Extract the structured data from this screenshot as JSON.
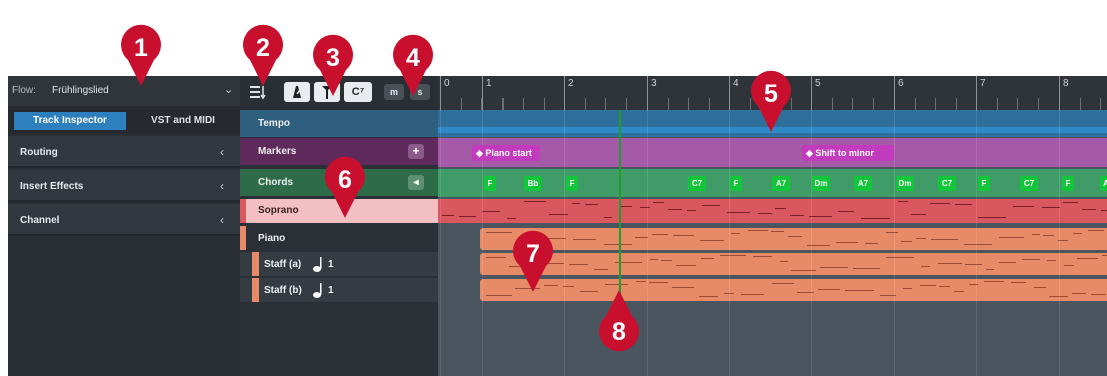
{
  "flow": {
    "label": "Flow:",
    "value": "Frühlingslied",
    "chevron": "⌄"
  },
  "tabs": [
    {
      "label": "Track Inspector",
      "active": true
    },
    {
      "label": "VST and MIDI",
      "active": false
    }
  ],
  "sections": [
    {
      "label": "Routing",
      "chevron": "‹"
    },
    {
      "label": "Insert Effects",
      "chevron": "‹"
    },
    {
      "label": "Channel",
      "chevron": "‹"
    }
  ],
  "toolbar": {
    "sort_icon": "sort-icon",
    "metronome_icon": "metronome-icon",
    "marker_icon": "marker-icon",
    "chord_label": "C⁷",
    "mute_label": "m",
    "solo_label": "s"
  },
  "ruler": {
    "bars": [
      "0",
      "1",
      "2",
      "3",
      "4",
      "5",
      "6",
      "7",
      "8"
    ]
  },
  "tracks": [
    {
      "label": "Tempo",
      "color": "#2f5f7e"
    },
    {
      "label": "Markers",
      "color": "#5e2a5c"
    },
    {
      "label": "Chords",
      "color": "#2e6b49"
    },
    {
      "label": "Soprano",
      "color": "#f2c0c2"
    },
    {
      "label": "Piano",
      "color": "#2b3037"
    },
    {
      "label": "Staff (a)",
      "voice": "1",
      "color": "#2b3037"
    },
    {
      "label": "Staff (b)",
      "voice": "1",
      "color": "#2b3037"
    }
  ],
  "markers": [
    {
      "label": "Piano start",
      "icon": "◆"
    },
    {
      "label": "Shift to minor",
      "icon": "◆"
    }
  ],
  "chords": [
    "F",
    "Bb",
    "F",
    "C7",
    "F",
    "A7",
    "Dm",
    "A7",
    "Dm",
    "C7",
    "F",
    "C7",
    "F",
    "A"
  ],
  "callouts": [
    "1",
    "2",
    "3",
    "4",
    "5",
    "6",
    "7",
    "8"
  ],
  "colors": {
    "callout": "#c8102e",
    "tempo": "#2f89c8",
    "markers": "#a55aa8",
    "chords": "#3f9c68",
    "chord_chip": "#12c63a",
    "soprano": "#d9575f",
    "piano": "#e68a68",
    "playhead": "#1ea028",
    "accent": "#2e7fbd"
  },
  "add_label": "+",
  "mute_glyph": "◂"
}
